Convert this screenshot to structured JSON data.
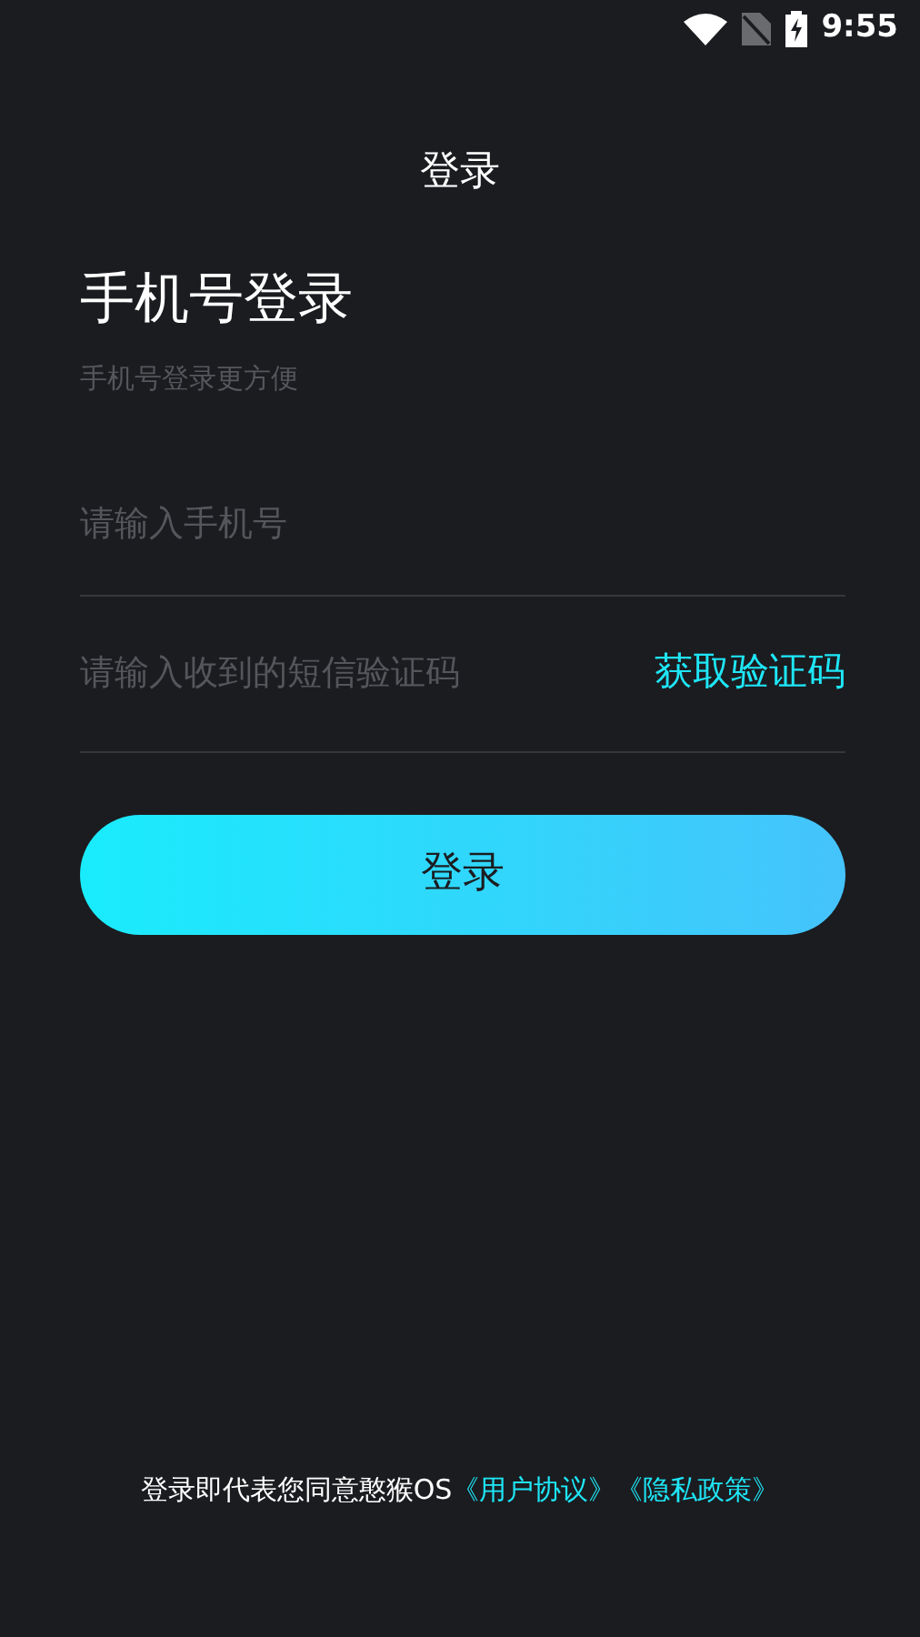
{
  "status_bar": {
    "time": "9:55"
  },
  "title": "登录",
  "heading": "手机号登录",
  "subtitle": "手机号登录更方便",
  "phone_field": {
    "placeholder": "请输入手机号"
  },
  "code_field": {
    "placeholder": "请输入收到的短信验证码"
  },
  "get_code_link": "获取验证码",
  "login_button": "登录",
  "footer": {
    "text": "登录即代表您同意憨猴OS",
    "links": [
      "《用户协议》",
      "《隐私政策》"
    ]
  }
}
